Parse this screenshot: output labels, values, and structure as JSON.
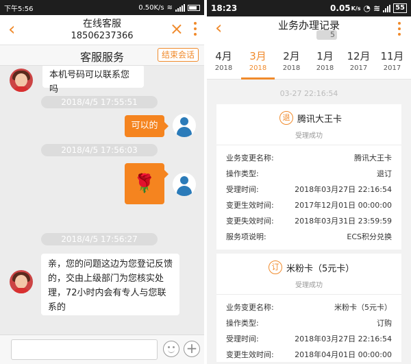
{
  "left": {
    "status_bar": {
      "time": "下午5:56",
      "speed": "0.50K/s"
    },
    "header": {
      "back_icon": "‹",
      "title": "在线客服",
      "phone": "18506237366",
      "close_icon": "×"
    },
    "subbar": {
      "title": "客服服务",
      "end_label": "结束会话"
    },
    "messages": {
      "m1_text": "本机号码可以联系您吗",
      "ts1": "2018/4/5 17:55:51",
      "m2_text": "可以的",
      "ts2": "2018/4/5 17:56:03",
      "m3_emoji": "🌹",
      "ts3": "2018/4/5 17:56:27",
      "m4_text": "亲，您的问题这边为您登记反馈的，交由上级部门为您核实处理，72小时内会有专人与您联系的"
    },
    "input": {
      "plus_label": "+"
    }
  },
  "right": {
    "status_bar": {
      "time": "18:23",
      "speed": "0.05",
      "speed_unit": "K/s",
      "battery": "55"
    },
    "header": {
      "back_icon": "‹",
      "title": "业务办理记录",
      "sub_suffix": "5"
    },
    "tabs": [
      {
        "month": "4月",
        "year": "2018"
      },
      {
        "month": "3月",
        "year": "2018"
      },
      {
        "month": "2月",
        "year": "2018"
      },
      {
        "month": "1月",
        "year": "2018"
      },
      {
        "month": "12月",
        "year": "2017"
      },
      {
        "month": "11月",
        "year": "2017"
      }
    ],
    "active_tab": 1,
    "record_time": "03-27 22:16:54",
    "records": [
      {
        "badge": "退",
        "name": "腾讯大王卡",
        "status": "受理成功",
        "rows": [
          {
            "k": "业务变更名称:",
            "v": "腾讯大王卡"
          },
          {
            "k": "操作类型:",
            "v": "退订"
          },
          {
            "k": "受理时间:",
            "v": "2018年03月27日 22:16:54"
          },
          {
            "k": "变更生效时间:",
            "v": "2017年12月01日 00:00:00"
          },
          {
            "k": "变更失效时间:",
            "v": "2018年03月31日 23:59:59"
          },
          {
            "k": "服务项说明:",
            "v": "ECS积分兑换"
          }
        ]
      },
      {
        "badge": "订",
        "name": "米粉卡（5元卡）",
        "status": "受理成功",
        "rows": [
          {
            "k": "业务变更名称:",
            "v": "米粉卡（5元卡）"
          },
          {
            "k": "操作类型:",
            "v": "订购"
          },
          {
            "k": "受理时间:",
            "v": "2018年03月27日 22:16:54"
          },
          {
            "k": "变更生效时间:",
            "v": "2018年04月01日 00:00:00"
          }
        ]
      }
    ]
  }
}
